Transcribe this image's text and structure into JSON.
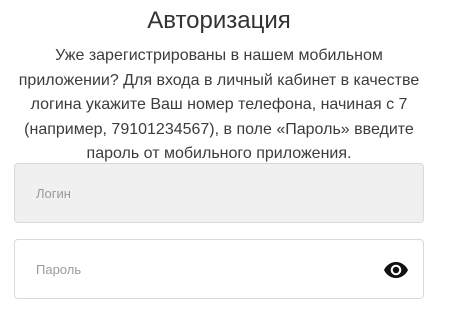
{
  "title": "Авторизация",
  "description": "Уже зарегистрированы в нашем мобильном приложении? Для входа в личный кабинет в качестве логина укажите Ваш номер телефона, начиная с 7 (например, 79101234567), в поле «Пароль» введите пароль от мобильного приложения.",
  "login_field": {
    "value": "",
    "placeholder": "Логин"
  },
  "password_field": {
    "value": "",
    "placeholder": "Пароль",
    "toggle_icon": "eye-icon"
  },
  "colors": {
    "text": "#333333",
    "placeholder": "#9a9a9a",
    "field_border": "#d9d9d9",
    "login_field_bg": "#f0f0f0",
    "icon": "#111111"
  }
}
